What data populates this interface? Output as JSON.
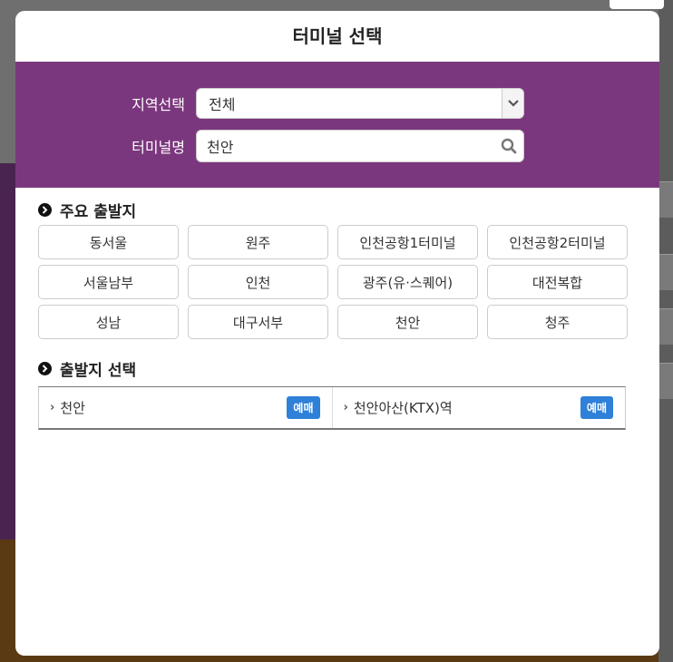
{
  "modal": {
    "title": "터미널 선택"
  },
  "filters": {
    "region_label": "지역선택",
    "region_value": "전체",
    "terminal_label": "터미널명",
    "terminal_value": "천안"
  },
  "major_departures": {
    "title": "주요 출발지",
    "items": [
      "동서울",
      "원주",
      "인천공항1터미널",
      "인천공항2터미널",
      "서울남부",
      "인천",
      "광주(유·스퀘어)",
      "대전복합",
      "성남",
      "대구서부",
      "천안",
      "청주"
    ]
  },
  "departure_select": {
    "title": "출발지 선택",
    "results": [
      {
        "name": "천안",
        "action": "예매"
      },
      {
        "name": "천안아산(KTX)역",
        "action": "예매"
      }
    ]
  },
  "colors": {
    "band": "#7b377d",
    "reserve_button": "#2f80d8"
  }
}
